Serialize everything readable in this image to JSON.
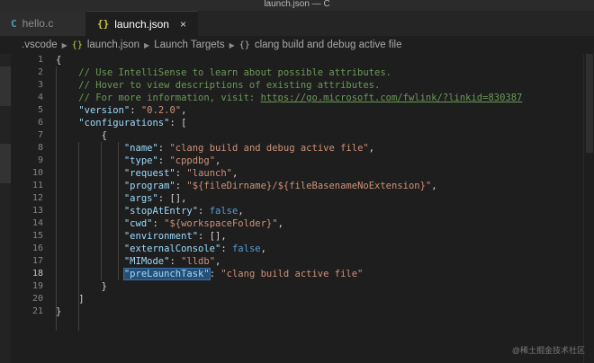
{
  "window": {
    "title": "launch.json — C"
  },
  "tabs": [
    {
      "label": "hello.c",
      "icon": "c-file-icon",
      "icon_glyph": "C"
    },
    {
      "label": "launch.json",
      "icon": "json-file-icon",
      "icon_glyph": "{}",
      "close": "×"
    }
  ],
  "breadcrumb": {
    "items": [
      ".vscode",
      "launch.json",
      "Launch Targets",
      "clang build and debug active file"
    ],
    "glyph_json": "{}",
    "glyph_obj": "{}"
  },
  "editor": {
    "current_line": 18,
    "line_numbers": [
      "1",
      "2",
      "3",
      "4",
      "5",
      "6",
      "7",
      "8",
      "9",
      "10",
      "11",
      "12",
      "13",
      "14",
      "15",
      "16",
      "17",
      "18",
      "19",
      "20",
      "21"
    ],
    "lines": {
      "l1": "{",
      "l2": "    // Use IntelliSense to learn about possible attributes.",
      "l3": "    // Hover to view descriptions of existing attributes.",
      "l4_text": "    // For more information, visit: ",
      "l4_link": "https://go.microsoft.com/fwlink/?linkid=830387",
      "l5_key": "\"version\"",
      "l5_val": "\"0.2.0\"",
      "l6_key": "\"configurations\"",
      "l6_rest": ": [",
      "l7": "{",
      "l8_key": "\"name\"",
      "l8_val": "\"clang build and debug active file\"",
      "l9_key": "\"type\"",
      "l9_val": "\"cppdbg\"",
      "l10_key": "\"request\"",
      "l10_val": "\"launch\"",
      "l11_key": "\"program\"",
      "l11_val": "\"${fileDirname}/${fileBasenameNoExtension}\"",
      "l12_key": "\"args\"",
      "l12_val": "[]",
      "l13_key": "\"stopAtEntry\"",
      "l13_val": "false",
      "l14_key": "\"cwd\"",
      "l14_val": "\"${workspaceFolder}\"",
      "l15_key": "\"environment\"",
      "l15_val": "[]",
      "l16_key": "\"externalConsole\"",
      "l16_val": "false",
      "l17_key": "\"MIMode\"",
      "l17_val": "\"lldb\"",
      "l18_key": "\"preLaunchTask\"",
      "l18_val": "\"clang build active file\"",
      "l19": "}",
      "l20": "]",
      "l21": "}"
    }
  },
  "watermark": "@稀土掘金技术社区",
  "colors": {
    "comment": "#6a9955",
    "key": "#9cdcfe",
    "string": "#ce9178",
    "keyword": "#569cd6",
    "background": "#1e1e1e"
  }
}
